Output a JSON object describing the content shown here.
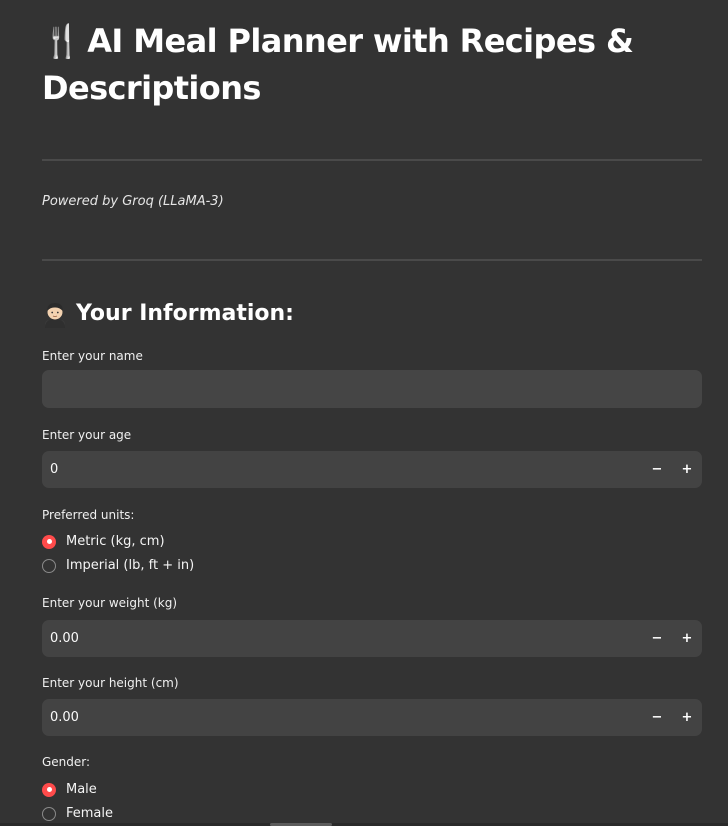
{
  "header": {
    "title_emoji": "🍴",
    "title": "AI Meal Planner with Recipes & Descriptions",
    "subtitle": "Powered by Groq (LLaMA-3)"
  },
  "section": {
    "emoji": "person-icon",
    "heading": "Your Information:"
  },
  "form": {
    "name": {
      "label": "Enter your name",
      "value": ""
    },
    "age": {
      "label": "Enter your age",
      "value": "0",
      "minus": "−",
      "plus": "+"
    },
    "units": {
      "label": "Preferred units:",
      "options": [
        "Metric (kg, cm)",
        "Imperial (lb, ft + in)"
      ],
      "selected": "Metric (kg, cm)"
    },
    "weight": {
      "label": "Enter your weight (kg)",
      "value": "0.00",
      "minus": "−",
      "plus": "+"
    },
    "height": {
      "label": "Enter your height (cm)",
      "value": "0.00",
      "minus": "−",
      "plus": "+"
    },
    "gender": {
      "label": "Gender:",
      "options": [
        "Male",
        "Female"
      ],
      "selected": "Male"
    }
  },
  "colors": {
    "background": "#333333",
    "input_bg": "#454545",
    "accent": "#ff4b4b",
    "divider": "#4a4a4a"
  }
}
